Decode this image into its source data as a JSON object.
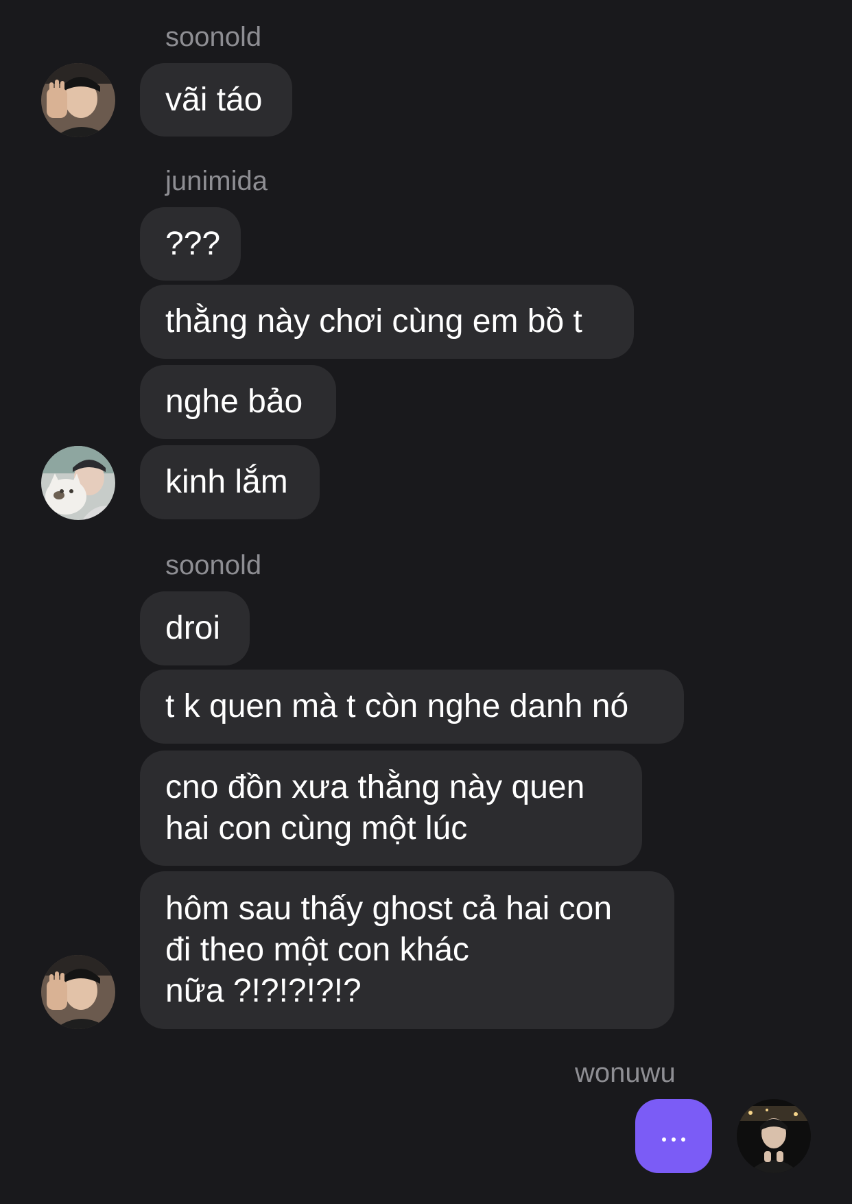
{
  "chat": {
    "groups": [
      {
        "sender": "soonold",
        "avatar_icon": "user-avatar-soonold",
        "messages": [
          "vãi táo"
        ]
      },
      {
        "sender": "junimida",
        "avatar_icon": "user-avatar-junimida",
        "messages": [
          "???",
          "thằng này chơi cùng em bồ t",
          "nghe bảo",
          "kinh lắm"
        ]
      },
      {
        "sender": "soonold",
        "avatar_icon": "user-avatar-soonold",
        "messages": [
          "droi",
          "t k quen mà t còn nghe danh nó",
          "cno đồn xưa thằng này quen",
          "hai con cùng một lúc",
          "hôm sau thấy ghost cả hai con",
          "đi theo một con khác",
          "nữa ?!?!?!?!?"
        ]
      }
    ],
    "typing": {
      "sender": "wonuwu",
      "indicator_icon": "typing-dots-icon",
      "avatar_icon": "user-avatar-wonuwu"
    }
  },
  "colors": {
    "background": "#19191c",
    "bubble": "#2c2c2f",
    "sender_name": "#8e8e93",
    "message_text": "#ffffff",
    "typing_bubble": "#7b5cf6"
  }
}
